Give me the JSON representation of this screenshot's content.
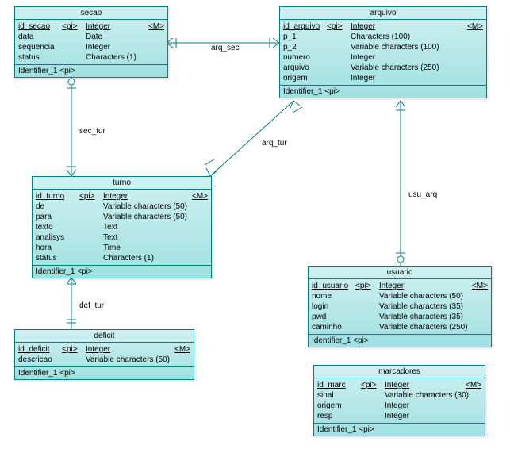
{
  "chart_data": {
    "type": "diagram",
    "diagram_type": "ER / CDM",
    "entities": [
      {
        "name": "secao",
        "attributes": [
          {
            "name": "id_secao",
            "pi": "<pi>",
            "type": "Integer",
            "m": "<M>",
            "pk": true
          },
          {
            "name": "data",
            "pi": "",
            "type": "Date",
            "m": ""
          },
          {
            "name": "sequencia",
            "pi": "",
            "type": "Integer",
            "m": ""
          },
          {
            "name": "status",
            "pi": "",
            "type": "Characters (1)",
            "m": ""
          }
        ],
        "identifier": "Identifier_1  <pi>"
      },
      {
        "name": "arquivo",
        "attributes": [
          {
            "name": "id_arquivo",
            "pi": "<pi>",
            "type": "Integer",
            "m": "<M>",
            "pk": true
          },
          {
            "name": "p_1",
            "pi": "",
            "type": "Characters (100)",
            "m": ""
          },
          {
            "name": "p_2",
            "pi": "",
            "type": "Variable characters (100)",
            "m": ""
          },
          {
            "name": "numero",
            "pi": "",
            "type": "Integer",
            "m": ""
          },
          {
            "name": "arquivo",
            "pi": "",
            "type": "Variable characters (250)",
            "m": ""
          },
          {
            "name": "origem",
            "pi": "",
            "type": "Integer",
            "m": ""
          }
        ],
        "identifier": "Identifier_1  <pi>"
      },
      {
        "name": "turno",
        "attributes": [
          {
            "name": "id_turno",
            "pi": "<pi>",
            "type": "Integer",
            "m": "<M>",
            "pk": true
          },
          {
            "name": "de",
            "pi": "",
            "type": "Variable characters (50)",
            "m": ""
          },
          {
            "name": "para",
            "pi": "",
            "type": "Variable characters (50)",
            "m": ""
          },
          {
            "name": "texto",
            "pi": "",
            "type": "Text",
            "m": ""
          },
          {
            "name": "analisys",
            "pi": "",
            "type": "Text",
            "m": ""
          },
          {
            "name": "hora",
            "pi": "",
            "type": "Time",
            "m": ""
          },
          {
            "name": "status",
            "pi": "",
            "type": "Characters (1)",
            "m": ""
          }
        ],
        "identifier": "Identifier_1  <pi>"
      },
      {
        "name": "usuario",
        "attributes": [
          {
            "name": "id_usuario",
            "pi": "<pi>",
            "type": "Integer",
            "m": "<M>",
            "pk": true
          },
          {
            "name": "nome",
            "pi": "",
            "type": "Variable characters (50)",
            "m": ""
          },
          {
            "name": "login",
            "pi": "",
            "type": "Variable characters (35)",
            "m": ""
          },
          {
            "name": "pwd",
            "pi": "",
            "type": "Variable characters (35)",
            "m": ""
          },
          {
            "name": "caminho",
            "pi": "",
            "type": "Variable characters (250)",
            "m": ""
          }
        ],
        "identifier": "Identifier_1  <pi>"
      },
      {
        "name": "deficit",
        "attributes": [
          {
            "name": "id_deficit",
            "pi": "<pi>",
            "type": "Integer",
            "m": "<M>",
            "pk": true
          },
          {
            "name": "descricao",
            "pi": "",
            "type": "Variable characters (50)",
            "m": ""
          }
        ],
        "identifier": "Identifier_1  <pi>"
      },
      {
        "name": "marcadores",
        "attributes": [
          {
            "name": "id_marc",
            "pi": "<pi>",
            "type": "Integer",
            "m": "<M>",
            "pk": true
          },
          {
            "name": "sinal",
            "pi": "",
            "type": "Variable characters (30)",
            "m": ""
          },
          {
            "name": "origem",
            "pi": "",
            "type": "Integer",
            "m": ""
          },
          {
            "name": "resp",
            "pi": "",
            "type": "Integer",
            "m": ""
          }
        ],
        "identifier": "Identifier_1  <pi>"
      }
    ],
    "relationships": [
      {
        "name": "arq_sec",
        "from": "secao",
        "to": "arquivo"
      },
      {
        "name": "sec_tur",
        "from": "secao",
        "to": "turno"
      },
      {
        "name": "arq_tur",
        "from": "arquivo",
        "to": "turno"
      },
      {
        "name": "usu_arq",
        "from": "arquivo",
        "to": "usuario"
      },
      {
        "name": "def_tur",
        "from": "turno",
        "to": "deficit"
      }
    ]
  },
  "labels": {
    "arq_sec": "arq_sec",
    "sec_tur": "sec_tur",
    "arq_tur": "arq_tur",
    "usu_arq": "usu_arq",
    "def_tur": "def_tur"
  }
}
